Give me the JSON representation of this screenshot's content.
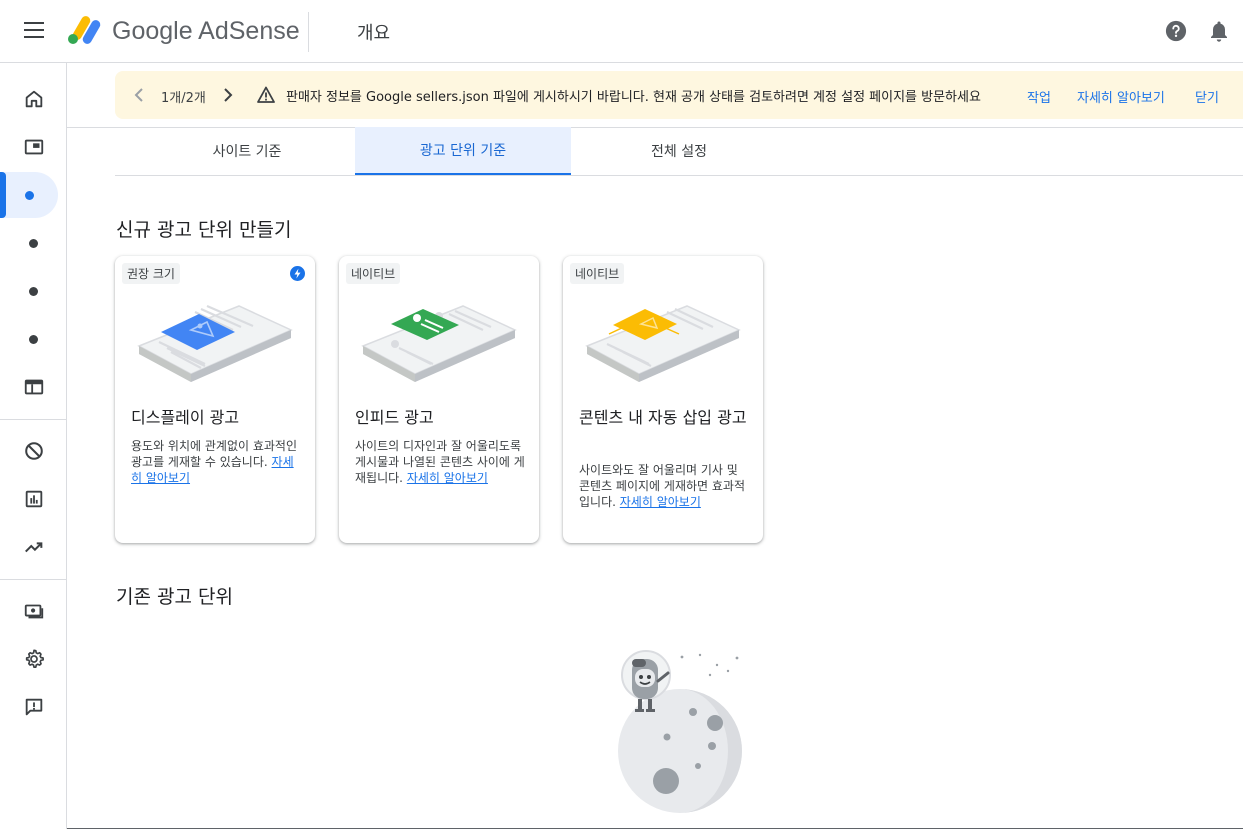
{
  "header": {
    "brand": "Google AdSense",
    "page_title": "개요"
  },
  "banner": {
    "count": "1개/2개",
    "message": "판매자 정보를 Google sellers.json 파일에 게시하시기 바랍니다. 현재 공개 상태를 검토하려면 계정 설정 페이지를 방문하세요",
    "action_label": "작업",
    "learn_more_label": "자세히 알아보기",
    "close_label": "닫기",
    "background": "#fef7e0"
  },
  "tabs": [
    {
      "label": "사이트 기준"
    },
    {
      "label": "광고 단위 기준",
      "active": true
    },
    {
      "label": "전체 설정"
    }
  ],
  "new_units": {
    "title": "신규 광고 단위 만들기",
    "cards": [
      {
        "chip": "권장 크기",
        "title": "디스플레이 광고",
        "desc": "용도와 위치에 관계없이 효과적인 광고를 게재할 수 있습니다.",
        "link": "자세히 알아보기",
        "accent": "#4285f4"
      },
      {
        "chip": "네이티브",
        "title": "인피드 광고",
        "desc": "사이트의 디자인과 잘 어울리도록 게시물과 나열된 콘텐츠 사이에 게재됩니다.",
        "link": "자세히 알아보기",
        "accent": "#34a853"
      },
      {
        "chip": "네이티브",
        "title": "콘텐츠 내 자동 삽입 광고",
        "desc": "사이트와도 잘 어울리며 기사 및 콘텐츠 페이지에 게재하면 효과적입니다.",
        "link": "자세히 알아보기",
        "accent": "#fbbc04"
      }
    ]
  },
  "existing_units": {
    "title": "기존 광고 단위"
  },
  "colors": {
    "accent": "#1a73e8",
    "active_tab_bg": "#e8f0fe"
  },
  "sidebar_icons": [
    "home-icon",
    "site-icon",
    "nav-dot",
    "nav-dot",
    "nav-dot",
    "nav-dot",
    "layout-icon",
    "block-icon",
    "report-icon",
    "trending-icon",
    "payments-icon",
    "settings-icon",
    "feedback-icon"
  ]
}
